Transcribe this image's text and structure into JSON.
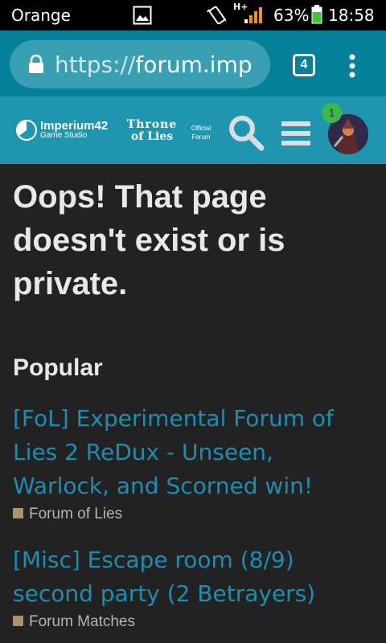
{
  "status_bar": {
    "carrier": "Orange",
    "network": "H+",
    "battery_percent": "63%",
    "time": "18:58"
  },
  "browser": {
    "url_scheme": "https://",
    "url_host": "forum.imp",
    "tab_count": "4"
  },
  "header": {
    "studio_name": "Imperium42",
    "studio_sub": "Game Studio",
    "game_line1": "Throne",
    "game_line2": "of Lies",
    "official_line1": "Official",
    "official_line2": "Forum",
    "notification_count": "1",
    "accent_color": "#1f95b0"
  },
  "main": {
    "error_title": "Oops! That page doesn't exist or is private.",
    "popular_heading": "Popular",
    "topics": [
      {
        "title": "[FoL] Experimental Forum of Lies 2 ReDux - Unseen, Warlock, and Scorned win!",
        "category": "Forum of Lies",
        "category_color": "#a89470"
      },
      {
        "title": "[Misc] Escape room (8/9) second party (2 Betrayers)",
        "category": "Forum Matches",
        "category_color": "#a89470"
      }
    ]
  }
}
